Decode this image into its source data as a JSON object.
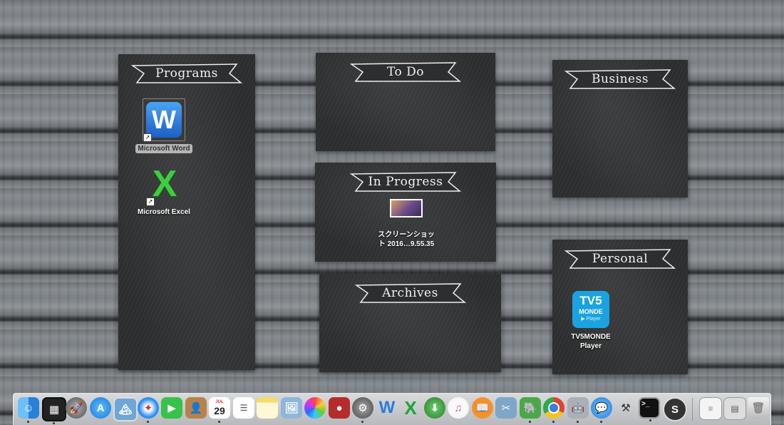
{
  "boards": {
    "programs": "Programs",
    "todo": "To Do",
    "business": "Business",
    "in_progress": "In Progress",
    "archives": "Archives",
    "personal": "Personal"
  },
  "icons": {
    "word": {
      "label": "Microsoft Word",
      "glyph": "W"
    },
    "excel": {
      "label": "Microsoft Excel",
      "glyph": "X"
    },
    "screenshot": {
      "line1": "スクリーンショッ",
      "line2": "ト 2016…9.55.35"
    },
    "tv5": {
      "line1": "TV5MONDE",
      "line2": "Player",
      "logo_top": "TV5",
      "logo_mid": "MONDE",
      "logo_bottom": "▶ Player"
    }
  },
  "dock": {
    "calendar_month": "JUL",
    "calendar_day": "29",
    "word_glyph": "W",
    "excel_glyph": "X",
    "terminal_glyph": ">_",
    "colors": {
      "finder": "#3fa0e8",
      "safari": "#2e8ff0",
      "facetime": "#37c24a",
      "word": "#2b7be0",
      "excel": "#1fa33a",
      "chrome": "#e34133",
      "evernote": "#4aa84a"
    }
  }
}
